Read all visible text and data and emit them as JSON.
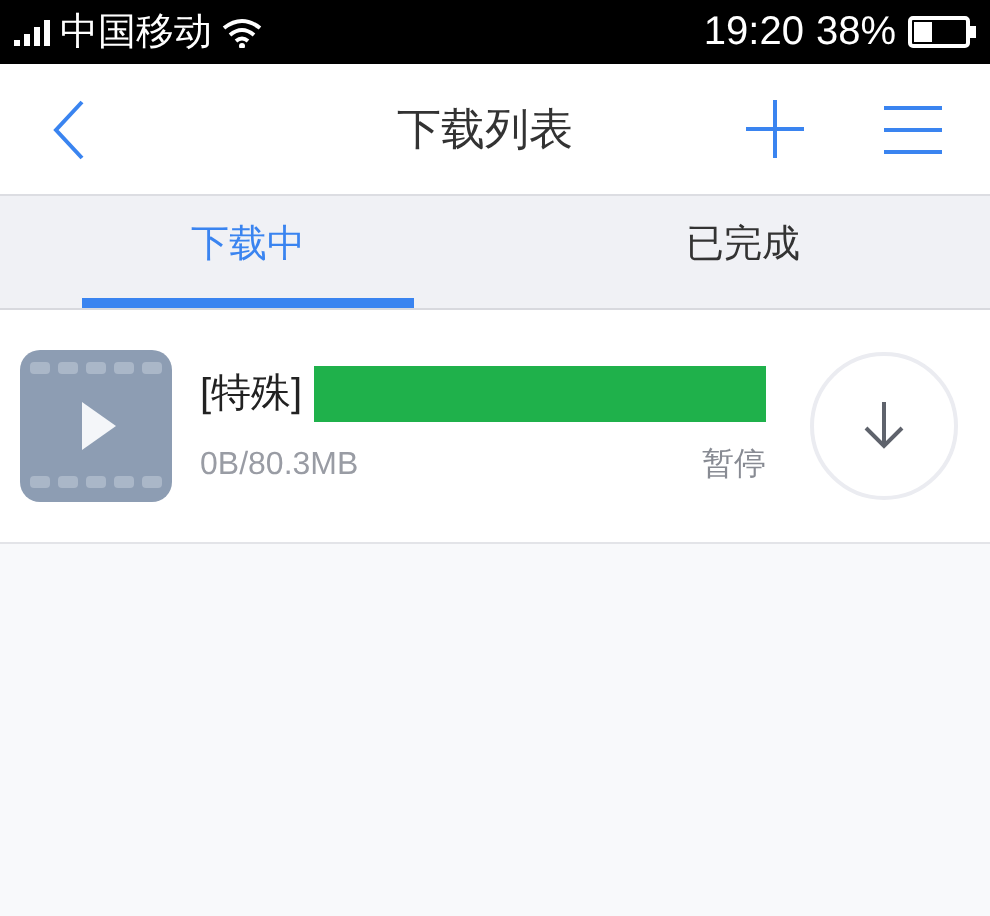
{
  "status_bar": {
    "carrier": "中国移动",
    "time": "19:20",
    "battery": "38%"
  },
  "nav": {
    "title": "下载列表"
  },
  "tabs": [
    {
      "label": "下载中",
      "selected": true
    },
    {
      "label": "已完成",
      "selected": false
    }
  ],
  "downloads": [
    {
      "kind": "video",
      "title": "[特殊]",
      "redacted": true,
      "size": "0B/80.3MB",
      "status": "暂停"
    }
  ]
}
